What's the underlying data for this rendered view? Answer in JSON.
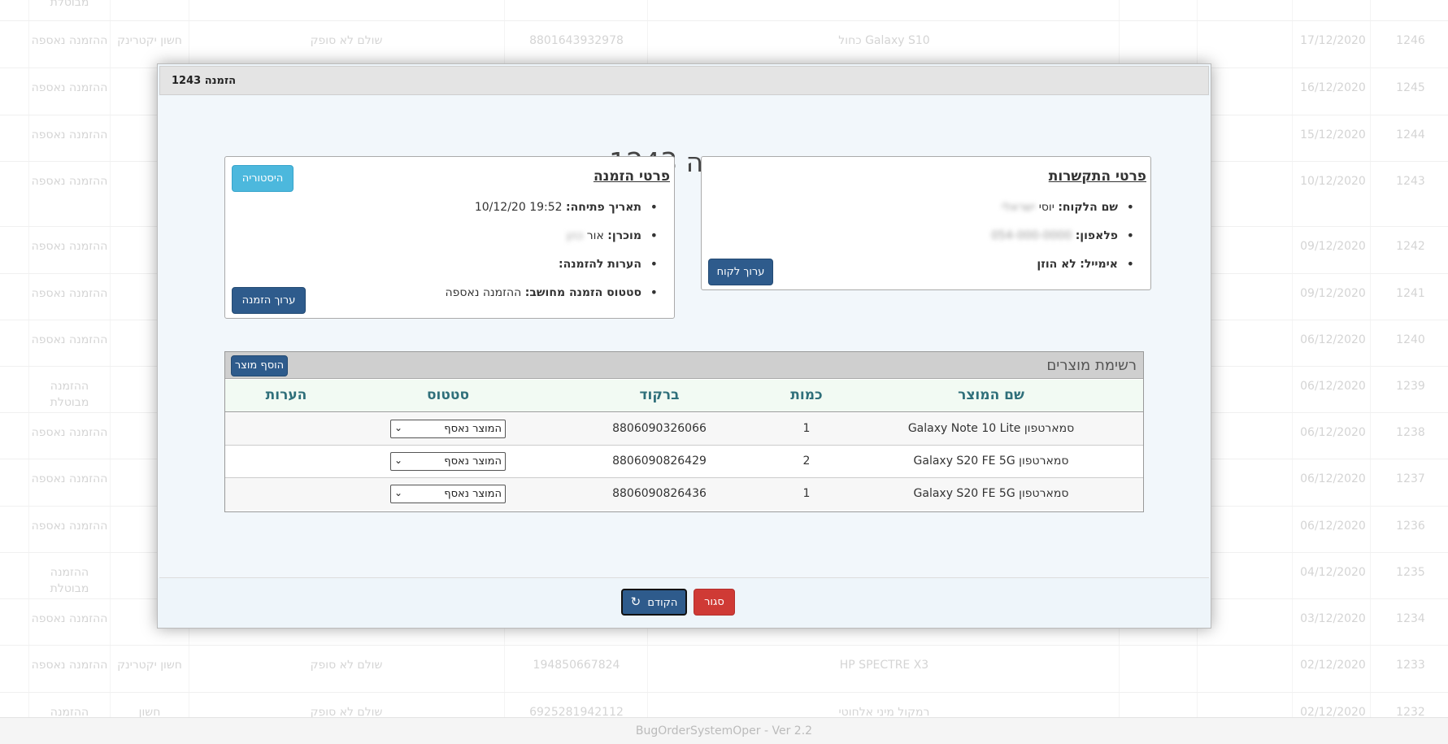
{
  "background": {
    "rows": [
      {
        "id": "",
        "date": "",
        "name": "",
        "phone": "",
        "product": "",
        "barcode": "",
        "payment": "",
        "seller": "",
        "status": "מבוטלת"
      },
      {
        "id": "1246",
        "date": "17/12/2020",
        "name": "",
        "phone": "",
        "product": "Galaxy S10 כחול",
        "barcode": "8801643932978",
        "payment": "שולם לא סופק",
        "seller": "חשון יקטרינק",
        "status": "ההזמנה נאספה"
      },
      {
        "id": "1245",
        "date": "16/12/2020",
        "name": "",
        "phone": "",
        "product": "",
        "barcode": "",
        "payment": "",
        "seller": "",
        "status": "ההזמנה נאספה"
      },
      {
        "id": "1244",
        "date": "15/12/2020",
        "name": "",
        "phone": "",
        "product": "",
        "barcode": "",
        "payment": "",
        "seller": "",
        "status": "ההזמנה נאספה"
      },
      {
        "id": "1243",
        "date": "10/12/2020",
        "name": "",
        "phone": "",
        "product": "",
        "barcode": "",
        "payment": "",
        "seller": "",
        "status": "ההזמנה נאספה"
      },
      {
        "id": "1242",
        "date": "09/12/2020",
        "name": "",
        "phone": "",
        "product": "",
        "barcode": "",
        "payment": "",
        "seller": "",
        "status": "ההזמנה נאספה"
      },
      {
        "id": "1241",
        "date": "09/12/2020",
        "name": "",
        "phone": "",
        "product": "",
        "barcode": "",
        "payment": "",
        "seller": "",
        "status": "ההזמנה נאספה"
      },
      {
        "id": "1240",
        "date": "06/12/2020",
        "name": "",
        "phone": "",
        "product": "",
        "barcode": "",
        "payment": "",
        "seller": "",
        "status": "ההזמנה נאספה"
      },
      {
        "id": "1239",
        "date": "06/12/2020",
        "name": "",
        "phone": "",
        "product": "",
        "barcode": "",
        "payment": "",
        "seller": "",
        "status": "ההזמנה מבוטלת"
      },
      {
        "id": "1238",
        "date": "06/12/2020",
        "name": "",
        "phone": "",
        "product": "",
        "barcode": "",
        "payment": "",
        "seller": "",
        "status": "ההזמנה נאספה"
      },
      {
        "id": "1237",
        "date": "06/12/2020",
        "name": "",
        "phone": "",
        "product": "",
        "barcode": "",
        "payment": "",
        "seller": "",
        "status": "ההזמנה נאספה"
      },
      {
        "id": "1236",
        "date": "06/12/2020",
        "name": "",
        "phone": "",
        "product": "",
        "barcode": "",
        "payment": "",
        "seller": "",
        "status": "ההזמנה נאספה"
      },
      {
        "id": "1235",
        "date": "04/12/2020",
        "name": "",
        "phone": "",
        "product": "",
        "barcode": "",
        "payment": "",
        "seller": "",
        "status": "ההזמנה מבוטלת"
      },
      {
        "id": "1234",
        "date": "03/12/2020",
        "name": "",
        "phone": "",
        "product": "",
        "barcode": "",
        "payment": "",
        "seller": "",
        "status": "ההזמנה נאספה"
      },
      {
        "id": "1233",
        "date": "02/12/2020",
        "name": "",
        "phone": "",
        "product": "HP SPECTRE X3",
        "barcode": "194850667824",
        "payment": "שולם לא סופק",
        "seller": "חשון יקטרינק",
        "status": "ההזמנה נאספה"
      },
      {
        "id": "1232",
        "date": "02/12/2020",
        "name": "",
        "phone": "",
        "product": "רמקול מיני אלחוטי",
        "barcode": "6925281942112",
        "payment": "שולם לא סופק",
        "seller": "חשון",
        "status": "ההזמנה"
      }
    ],
    "footer": "BugOrderSystemOper - Ver 2.2"
  },
  "modal": {
    "window_title": "הזמנה 1243",
    "heading": "הזמנה 1243",
    "contact": {
      "title": "פרטי התקשרות",
      "customer_label": "שם הלקוח:",
      "customer_value": "יוסי",
      "customer_hidden": "ישראלי",
      "phone_label": "פלאפון:",
      "phone_hidden": "054-000-0000",
      "email_label": "אימייל:",
      "email_value": "לא הוזן",
      "edit_customer_button": "ערוך לקוח"
    },
    "order": {
      "title": "פרטי הזמנה",
      "open_date_label": "תאריך פתיחה:",
      "open_date_value": "19:52 10/12/20",
      "seller_label": "מוכרן:",
      "seller_value": "אור",
      "seller_hidden": "כהן",
      "notes_label": "הערות להזמנה:",
      "status_label": "סטטוס הזמנה מחושב:",
      "status_value": "ההזמנה נאספה",
      "history_button": "היסטוריה",
      "edit_order_button": "ערוך הזמנה"
    },
    "products": {
      "title": "רשימת מוצרים",
      "add_button": "הוסף מוצר",
      "columns": [
        "שם המוצר",
        "כמות",
        "ברקוד",
        "סטטוס",
        "הערות"
      ],
      "rows": [
        {
          "name": "סמארטפון Galaxy Note 10 Lite",
          "qty": "1",
          "barcode": "8806090326066",
          "status": "המוצר נאסף",
          "notes": ""
        },
        {
          "name": "סמארטפון Galaxy S20 FE 5G",
          "qty": "2",
          "barcode": "8806090826429",
          "status": "המוצר נאסף",
          "notes": ""
        },
        {
          "name": "סמארטפון Galaxy S20 FE 5G",
          "qty": "1",
          "barcode": "8806090826436",
          "status": "המוצר נאסף",
          "notes": ""
        }
      ]
    },
    "footer": {
      "refresh_button": "הקודם",
      "refresh_icon": "refresh-icon",
      "close_button": "סגור"
    }
  },
  "colors": {
    "primary_button": "#2e5b8c",
    "info_button": "#4cb8dd",
    "danger_button": "#cf3a35",
    "table_header_text": "#2f6f7a"
  }
}
